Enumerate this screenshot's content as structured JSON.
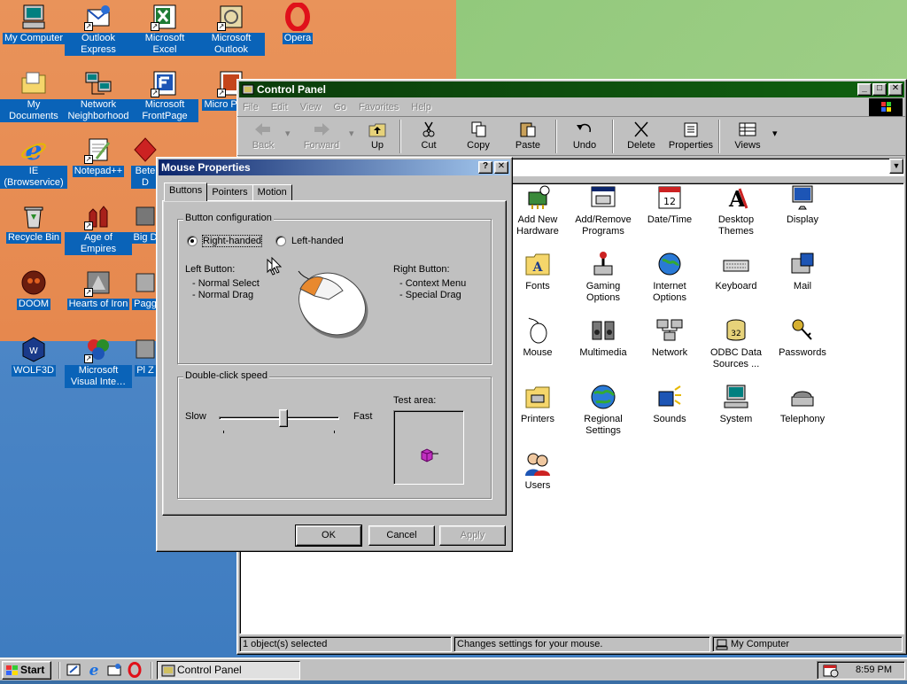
{
  "desktop": {
    "icons": [
      {
        "label": "My Computer",
        "icon": "computer-icon"
      },
      {
        "label": "Outlook Express",
        "icon": "outlook-express-icon"
      },
      {
        "label": "Microsoft Excel",
        "icon": "excel-icon"
      },
      {
        "label": "Microsoft Outlook",
        "icon": "outlook-icon"
      },
      {
        "label": "Opera",
        "icon": "opera-icon"
      },
      {
        "label": "My Documents",
        "icon": "folder-icon"
      },
      {
        "label": "Network Neighborhood",
        "icon": "network-icon"
      },
      {
        "label": "Microsoft FrontPage",
        "icon": "frontpage-icon"
      },
      {
        "label": "Micro Power",
        "icon": "powerpoint-icon"
      },
      {
        "label": "IE (Browservice)",
        "icon": "ie-icon"
      },
      {
        "label": "Notepad++",
        "icon": "notepad-icon"
      },
      {
        "label": "Bete D",
        "icon": "app-icon"
      },
      {
        "label": "Recycle Bin",
        "icon": "recycle-bin-icon"
      },
      {
        "label": "Age of Empires",
        "icon": "age-of-empires-icon"
      },
      {
        "label": "Big D",
        "icon": "app-icon"
      },
      {
        "label": "DOOM",
        "icon": "doom-icon"
      },
      {
        "label": "Hearts of Iron",
        "icon": "hearts-of-iron-icon"
      },
      {
        "label": "Pagg",
        "icon": "app-icon"
      },
      {
        "label": "WOLF3D",
        "icon": "wolf3d-icon"
      },
      {
        "label": "Microsoft Visual Inte…",
        "icon": "visual-interdev-icon"
      },
      {
        "label": "Pl Z",
        "icon": "app-icon"
      }
    ]
  },
  "control_panel": {
    "title": "Control Panel",
    "menu": [
      "File",
      "Edit",
      "View",
      "Go",
      "Favorites",
      "Help"
    ],
    "toolbar": [
      {
        "label": "Back",
        "icon": "back-arrow-icon",
        "enabled": false
      },
      {
        "label": "Forward",
        "icon": "forward-arrow-icon",
        "enabled": false
      },
      {
        "label": "Up",
        "icon": "up-folder-icon",
        "enabled": true
      },
      {
        "label": "Cut",
        "icon": "scissors-icon",
        "enabled": true
      },
      {
        "label": "Copy",
        "icon": "copy-icon",
        "enabled": true
      },
      {
        "label": "Paste",
        "icon": "paste-icon",
        "enabled": true
      },
      {
        "label": "Undo",
        "icon": "undo-icon",
        "enabled": true
      },
      {
        "label": "Delete",
        "icon": "delete-x-icon",
        "enabled": true
      },
      {
        "label": "Properties",
        "icon": "properties-icon",
        "enabled": true
      },
      {
        "label": "Views",
        "icon": "views-icon",
        "enabled": true
      }
    ],
    "items": [
      {
        "label": "Add New Hardware",
        "icon": "add-hardware-icon"
      },
      {
        "label": "Add/Remove Programs",
        "icon": "add-remove-programs-icon"
      },
      {
        "label": "Date/Time",
        "icon": "calendar-clock-icon"
      },
      {
        "label": "Desktop Themes",
        "icon": "desktop-themes-icon"
      },
      {
        "label": "Display",
        "icon": "display-icon"
      },
      {
        "label": "Fonts",
        "icon": "fonts-folder-icon"
      },
      {
        "label": "Gaming Options",
        "icon": "joystick-icon"
      },
      {
        "label": "Internet Options",
        "icon": "globe-internet-icon"
      },
      {
        "label": "Keyboard",
        "icon": "keyboard-icon"
      },
      {
        "label": "Mail",
        "icon": "mail-icon"
      },
      {
        "label": "Mouse",
        "icon": "mouse-icon"
      },
      {
        "label": "Multimedia",
        "icon": "multimedia-icon"
      },
      {
        "label": "Network",
        "icon": "network-computers-icon"
      },
      {
        "label": "ODBC Data Sources ...",
        "icon": "odbc-icon"
      },
      {
        "label": "Passwords",
        "icon": "keys-icon"
      },
      {
        "label": "Printers",
        "icon": "printers-folder-icon"
      },
      {
        "label": "Regional Settings",
        "icon": "globe-icon"
      },
      {
        "label": "Sounds",
        "icon": "speaker-icon"
      },
      {
        "label": "System",
        "icon": "system-computer-icon"
      },
      {
        "label": "Telephony",
        "icon": "telephone-icon"
      },
      {
        "label": "Users",
        "icon": "users-icon"
      }
    ],
    "status": {
      "selection": "1 object(s) selected",
      "description": "Changes settings for your mouse.",
      "zone": "My Computer"
    }
  },
  "mouse_dialog": {
    "title": "Mouse Properties",
    "help_button": "?",
    "close_button": "✕",
    "tabs": [
      "Buttons",
      "Pointers",
      "Motion"
    ],
    "active_tab": "Buttons",
    "button_config": {
      "group_label": "Button configuration",
      "right_handed": "Right-handed",
      "left_handed": "Left-handed",
      "selected": "right",
      "left_button_title": "Left Button:",
      "left_button_lines": [
        "-  Normal Select",
        "-  Normal Drag"
      ],
      "right_button_title": "Right Button:",
      "right_button_lines": [
        "-  Context Menu",
        "-  Special Drag"
      ]
    },
    "double_click": {
      "group_label": "Double-click speed",
      "slow": "Slow",
      "fast": "Fast",
      "speed_fraction": 0.5,
      "test_area": "Test area:"
    },
    "buttons": {
      "ok": "OK",
      "cancel": "Cancel",
      "apply": "Apply"
    }
  },
  "taskbar": {
    "start": "Start",
    "task": "Control Panel",
    "clock": "8:59 PM"
  },
  "colors": {
    "title_active": "#0a246a",
    "title_inactive": "#0b3d0b",
    "desktop_label_bg": "#0a63b8"
  }
}
